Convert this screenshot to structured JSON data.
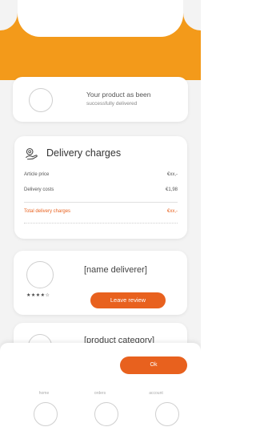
{
  "confirmation": {
    "line1": "Your product as been",
    "line2": "successfully delivered"
  },
  "charges": {
    "title": "Delivery charges",
    "rows": [
      {
        "label": "Article price",
        "value": "€xx,-"
      },
      {
        "label": "Delivery costs",
        "value": "€1,98"
      }
    ],
    "total": {
      "label": "Total delivery charges",
      "value": "€xx,-"
    },
    "note": "",
    "icon": "hand-with-coins-icon"
  },
  "deliverer": {
    "name": "[name deliverer]",
    "subtitle": "",
    "stars": "★★★★☆",
    "stars_sub": "",
    "review_button": "Leave review"
  },
  "product": {
    "name": "[product category]"
  },
  "sheet": {
    "ok_button": "Ok",
    "nav": [
      {
        "label": "home"
      },
      {
        "label": "orders"
      },
      {
        "label": "account"
      }
    ]
  },
  "colors": {
    "header": "#f39a1a",
    "accent": "#e8611e"
  }
}
